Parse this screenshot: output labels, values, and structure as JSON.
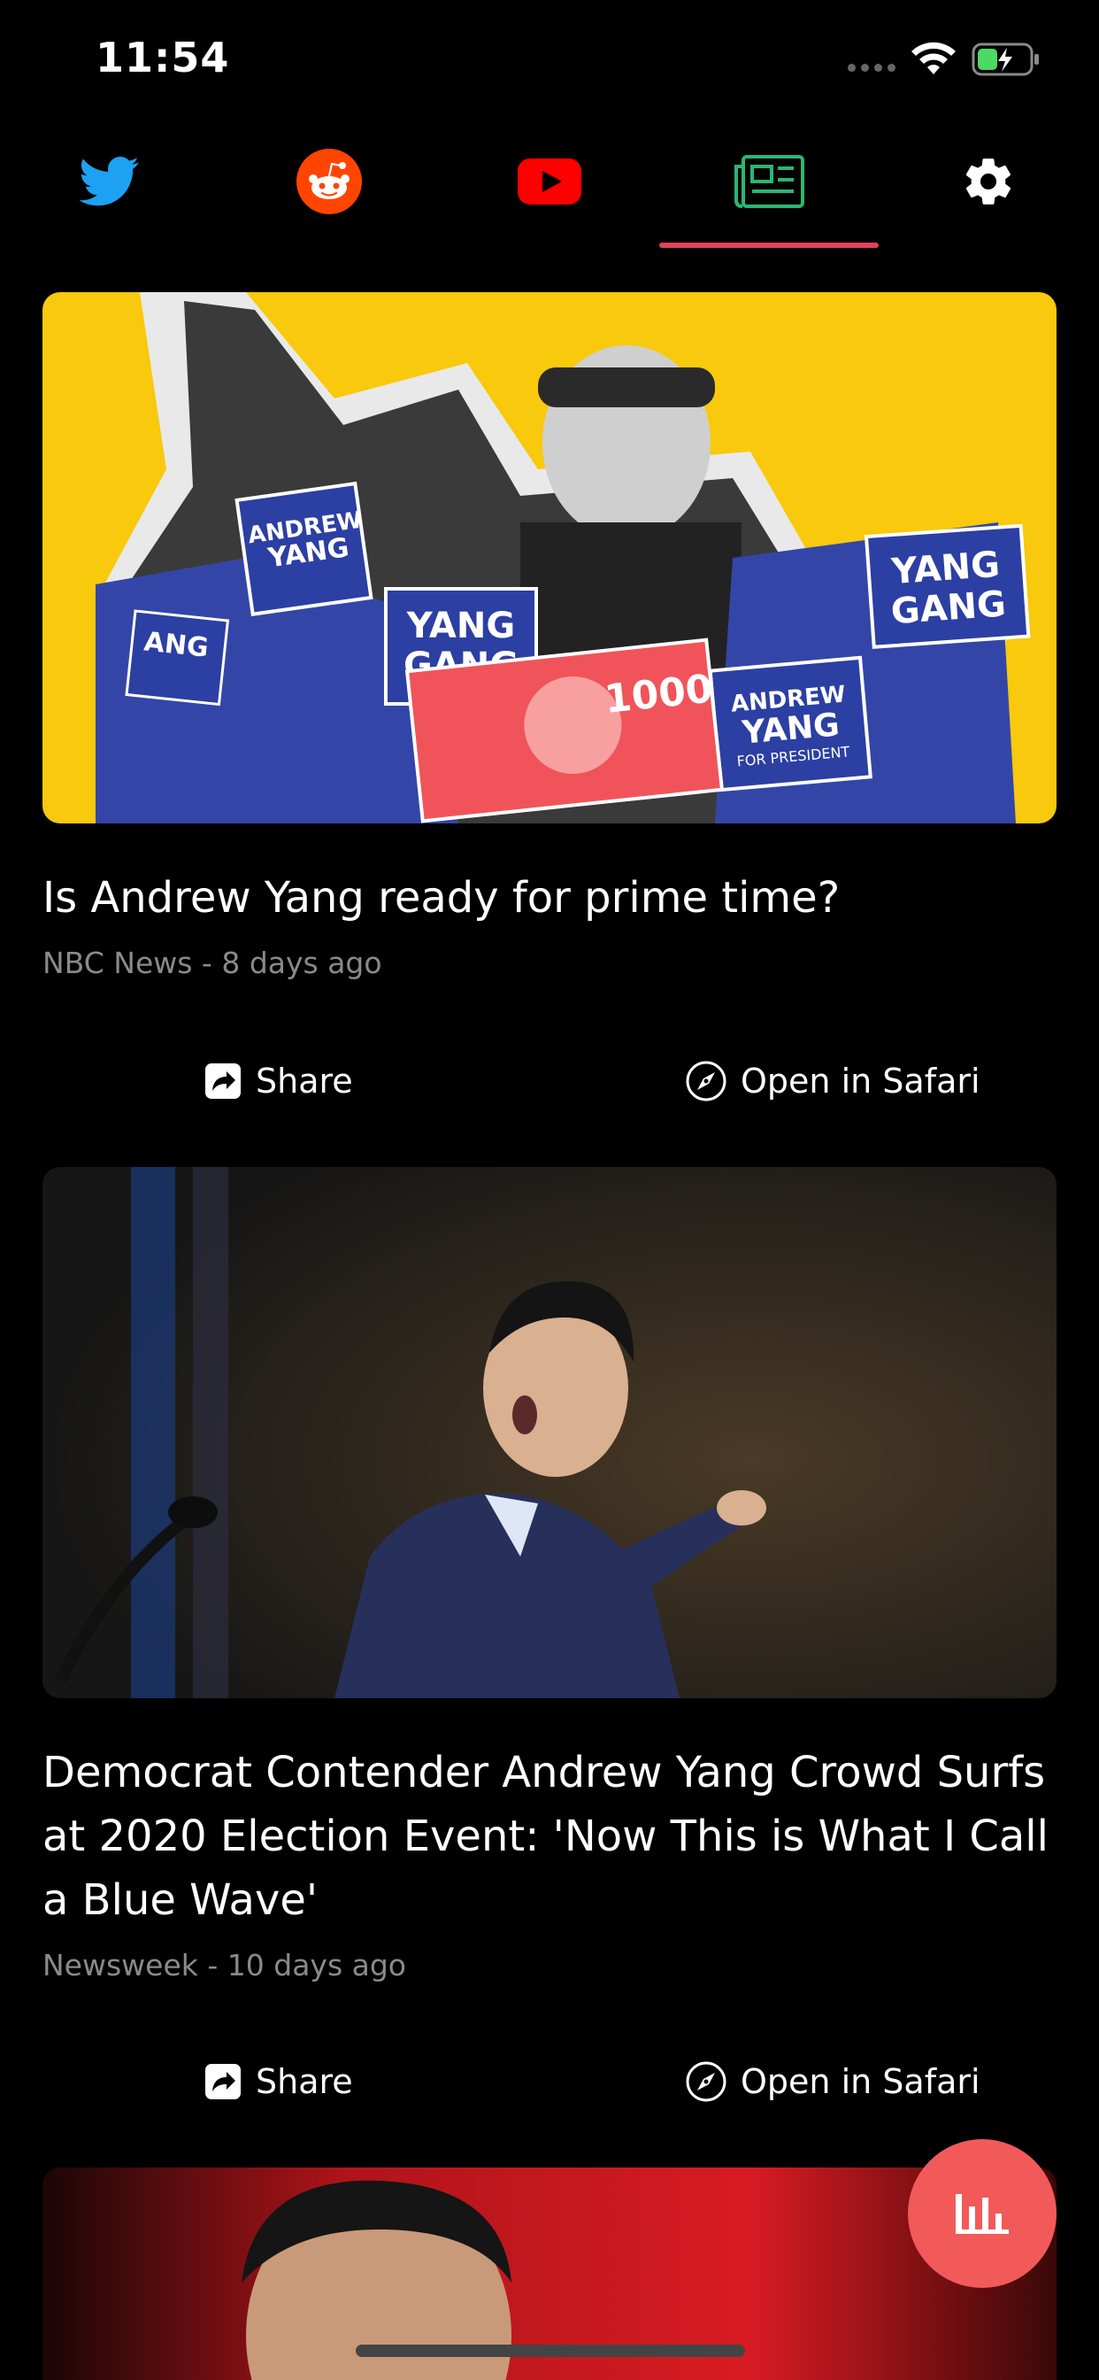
{
  "status_bar": {
    "time": "11:54"
  },
  "tabs": [
    {
      "icon": "twitter-icon",
      "color": "#1da1f2"
    },
    {
      "icon": "reddit-icon",
      "color": "#ff4500"
    },
    {
      "icon": "youtube-icon",
      "color": "#ff0000"
    },
    {
      "icon": "news-icon",
      "color": "#2bb673",
      "selected": true
    },
    {
      "icon": "gear-icon",
      "color": "#ffffff"
    }
  ],
  "accent_color": "#e0435a",
  "articles": [
    {
      "headline": "Is Andrew Yang ready for prime time?",
      "meta": "NBC News - 8 days ago",
      "share_label": "Share",
      "open_label": "Open in Safari"
    },
    {
      "headline": "Democrat Contender Andrew Yang Crowd Surfs at 2020 Election Event: 'Now This is What I Call a Blue Wave'",
      "meta": "Newsweek - 10 days ago",
      "share_label": "Share",
      "open_label": "Open in Safari"
    }
  ],
  "fab": {
    "icon": "bar-chart-icon",
    "color": "#f25a5a"
  }
}
